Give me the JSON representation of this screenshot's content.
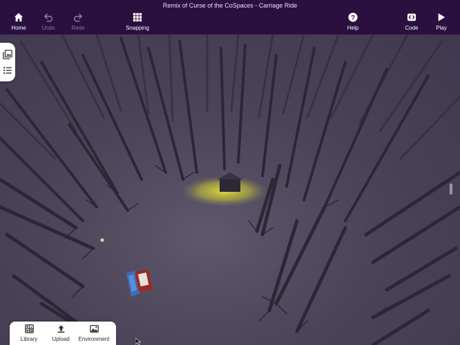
{
  "window": {
    "title": "Remix of Curse of the CoSpaces - Carriage Ride"
  },
  "toolbar": {
    "home": {
      "label": "Home",
      "icon": "home-icon"
    },
    "undo": {
      "label": "Undo",
      "icon": "undo-icon",
      "enabled": false
    },
    "redo": {
      "label": "Redo",
      "icon": "redo-icon",
      "enabled": false
    },
    "snapping": {
      "label": "Snapping",
      "icon": "grid-icon"
    },
    "help": {
      "label": "Help",
      "icon": "help-icon"
    },
    "code": {
      "label": "Code",
      "icon": "code-icon"
    },
    "play": {
      "label": "Play",
      "icon": "play-icon"
    }
  },
  "side_panel": {
    "items": [
      {
        "icon": "gallery-icon"
      },
      {
        "icon": "list-icon"
      }
    ]
  },
  "bottom_panel": {
    "library": {
      "label": "Library",
      "icon": "library-icon"
    },
    "upload": {
      "label": "Upload",
      "icon": "upload-icon"
    },
    "environment": {
      "label": "Environment",
      "icon": "environment-icon"
    }
  },
  "colors": {
    "toolbar_bg": "#2a0f3f",
    "scene_bg": "#4b4458",
    "tree": "#2e2637",
    "light": "#d9d63a"
  }
}
